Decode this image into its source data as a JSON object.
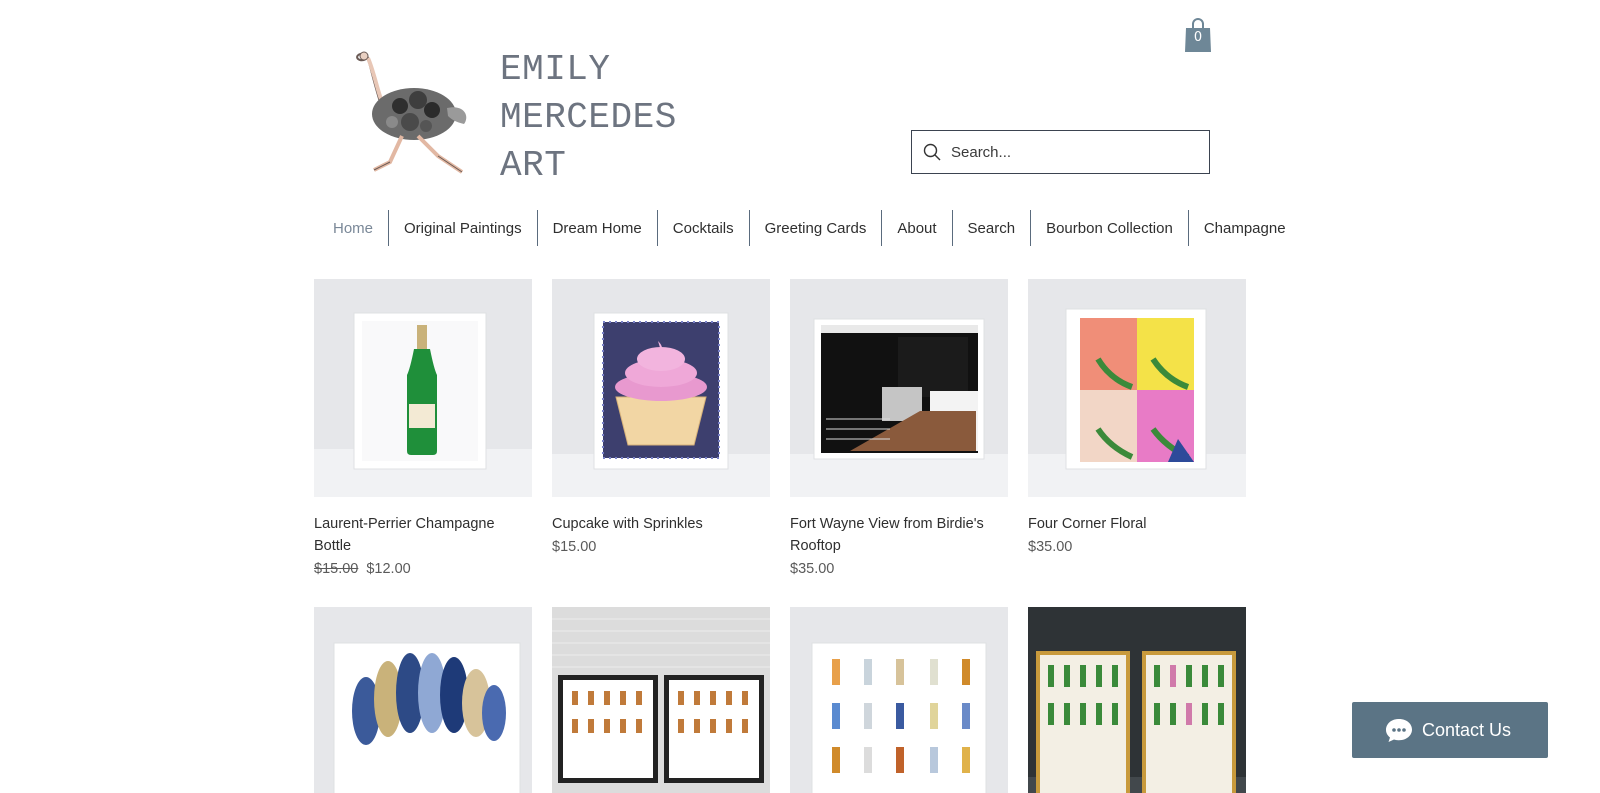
{
  "brand": {
    "line1": "EMILY",
    "line2": "MERCEDES",
    "line3": "ART"
  },
  "cart": {
    "count": "0"
  },
  "search": {
    "placeholder": "Search..."
  },
  "nav": {
    "items": [
      {
        "label": "Home"
      },
      {
        "label": "Original Paintings"
      },
      {
        "label": "Dream Home"
      },
      {
        "label": "Cocktails"
      },
      {
        "label": "Greeting Cards"
      },
      {
        "label": "About"
      },
      {
        "label": "Search"
      },
      {
        "label": "Bourbon Collection"
      },
      {
        "label": "Champagne"
      }
    ]
  },
  "products": [
    {
      "title": "Laurent-Perrier Champagne Bottle",
      "old_price": "$15.00",
      "price": "$12.00"
    },
    {
      "title": "Cupcake with Sprinkles",
      "price": "$15.00"
    },
    {
      "title": "Fort Wayne View from Birdie's Rooftop",
      "price": "$35.00"
    },
    {
      "title": "Four Corner Floral",
      "price": "$35.00"
    }
  ],
  "contact": {
    "label": "Contact Us"
  },
  "colors": {
    "accent": "#5b7485",
    "brand_text": "#6d7480",
    "nav_active": "#7a8898"
  }
}
